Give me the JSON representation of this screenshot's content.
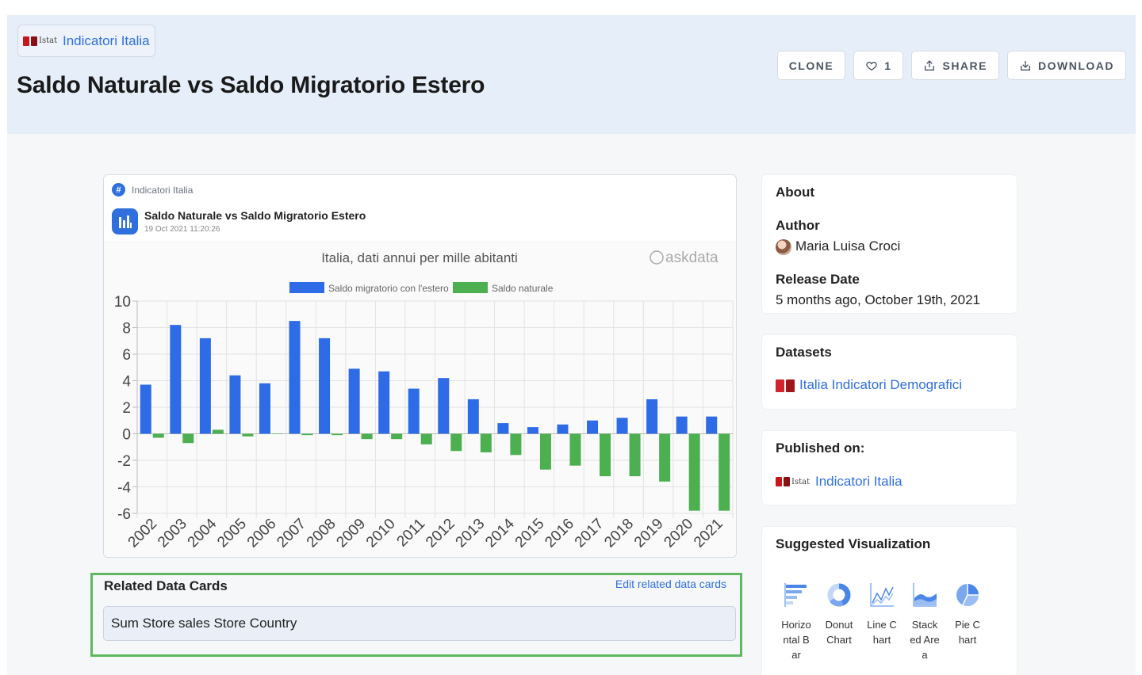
{
  "header": {
    "org_logo_text": "Istat",
    "org_name": "Indicatori Italia",
    "title": "Saldo Naturale vs Saldo Migratorio Estero",
    "actions": {
      "clone": "CLONE",
      "like_count": "1",
      "share": "SHARE",
      "download": "DOWNLOAD"
    }
  },
  "card": {
    "org": "Indicatori Italia",
    "hash_icon": "#",
    "title": "Saldo Naturale vs Saldo Migratorio Estero",
    "date": "19 Oct 2021 11:20:26",
    "watermark": "askdata"
  },
  "chart_data": {
    "type": "bar",
    "title": "Italia, dati annui per mille abitanti",
    "xlabel": "",
    "ylabel": "",
    "categories": [
      "2002",
      "2003",
      "2004",
      "2005",
      "2006",
      "2007",
      "2008",
      "2009",
      "2010",
      "2011",
      "2012",
      "2013",
      "2014",
      "2015",
      "2016",
      "2017",
      "2018",
      "2019",
      "2020",
      "2021"
    ],
    "series": [
      {
        "name": "Saldo migratorio con l'estero",
        "color": "#2e6be6",
        "values": [
          3.7,
          8.2,
          7.2,
          4.4,
          3.8,
          8.5,
          7.2,
          4.9,
          4.7,
          3.4,
          4.2,
          2.6,
          0.8,
          0.5,
          0.7,
          1.0,
          1.2,
          2.6,
          1.3,
          1.3
        ]
      },
      {
        "name": "Saldo naturale",
        "color": "#4caf50",
        "values": [
          -0.3,
          -0.7,
          0.3,
          -0.2,
          0.0,
          -0.1,
          -0.1,
          -0.4,
          -0.4,
          -0.8,
          -1.3,
          -1.4,
          -1.6,
          -2.7,
          -2.4,
          -3.2,
          -3.2,
          -3.6,
          -5.8,
          -5.8
        ]
      }
    ],
    "ylim": [
      -6,
      10
    ],
    "yticks": [
      10,
      8,
      6,
      4,
      2,
      0,
      -2,
      -4,
      -6
    ],
    "grid": true,
    "legend_position": "top"
  },
  "related": {
    "title": "Related Data Cards",
    "edit_label": "Edit related data cards",
    "items": [
      "Sum Store sales Store Country"
    ]
  },
  "sidebar": {
    "about": {
      "title": "About",
      "author_label": "Author",
      "author_name": "Maria Luisa Croci",
      "release_label": "Release Date",
      "release_value": "5 months ago, October 19th, 2021"
    },
    "datasets": {
      "title": "Datasets",
      "items": [
        "Italia Indicatori Demografici"
      ]
    },
    "published": {
      "title": "Published on:",
      "logo_text": "Istat",
      "org_name": "Indicatori Italia"
    },
    "suggested": {
      "title": "Suggested Visualization",
      "items": [
        {
          "label": "Horizontal Bar",
          "icon": "horizontal-bar-icon"
        },
        {
          "label": "Donut Chart",
          "icon": "donut-chart-icon"
        },
        {
          "label": "Line Chart",
          "icon": "line-chart-icon"
        },
        {
          "label": "Stacked Area",
          "icon": "stacked-area-icon"
        },
        {
          "label": "Pie Chart",
          "icon": "pie-chart-icon"
        }
      ]
    }
  }
}
